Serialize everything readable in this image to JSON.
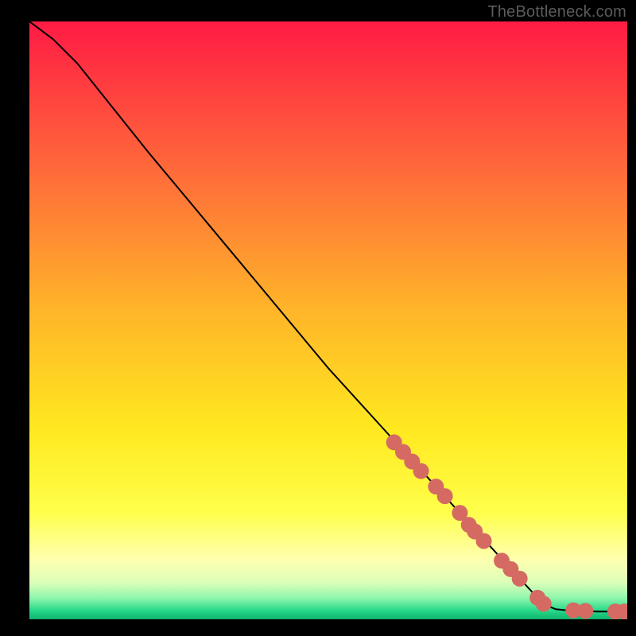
{
  "source_label": "TheBottleneck.com",
  "chart_data": {
    "type": "line",
    "title": "",
    "xlabel": "",
    "ylabel": "",
    "xlim": [
      0,
      100
    ],
    "ylim": [
      0,
      100
    ],
    "curve": [
      {
        "x": 0,
        "y": 100
      },
      {
        "x": 4,
        "y": 97
      },
      {
        "x": 8,
        "y": 93
      },
      {
        "x": 12,
        "y": 88
      },
      {
        "x": 20,
        "y": 78
      },
      {
        "x": 30,
        "y": 66
      },
      {
        "x": 40,
        "y": 54
      },
      {
        "x": 50,
        "y": 42
      },
      {
        "x": 60,
        "y": 31
      },
      {
        "x": 70,
        "y": 20
      },
      {
        "x": 80,
        "y": 9
      },
      {
        "x": 86,
        "y": 2.5
      },
      {
        "x": 88,
        "y": 1.7
      },
      {
        "x": 90,
        "y": 1.5
      },
      {
        "x": 95,
        "y": 1.3
      },
      {
        "x": 100,
        "y": 1.3
      }
    ],
    "markers": [
      {
        "x": 61.0,
        "y": 29.6
      },
      {
        "x": 62.5,
        "y": 28.0
      },
      {
        "x": 64.0,
        "y": 26.4
      },
      {
        "x": 65.5,
        "y": 24.8
      },
      {
        "x": 68.0,
        "y": 22.2
      },
      {
        "x": 69.5,
        "y": 20.6
      },
      {
        "x": 72.0,
        "y": 17.8
      },
      {
        "x": 73.5,
        "y": 15.8
      },
      {
        "x": 74.5,
        "y": 14.7
      },
      {
        "x": 76.0,
        "y": 13.1
      },
      {
        "x": 79.0,
        "y": 9.8
      },
      {
        "x": 80.5,
        "y": 8.4
      },
      {
        "x": 82.0,
        "y": 6.8
      },
      {
        "x": 85.0,
        "y": 3.6
      },
      {
        "x": 86.0,
        "y": 2.6
      },
      {
        "x": 91.0,
        "y": 1.5
      },
      {
        "x": 93.0,
        "y": 1.4
      },
      {
        "x": 98.0,
        "y": 1.3
      },
      {
        "x": 99.5,
        "y": 1.3
      }
    ],
    "gradient_stops": [
      {
        "offset": 0.0,
        "color": "#ff1b44"
      },
      {
        "offset": 0.25,
        "color": "#ff6a3a"
      },
      {
        "offset": 0.48,
        "color": "#ffb429"
      },
      {
        "offset": 0.68,
        "color": "#ffe81f"
      },
      {
        "offset": 0.82,
        "color": "#ffff4a"
      },
      {
        "offset": 0.9,
        "color": "#ffffb0"
      },
      {
        "offset": 0.94,
        "color": "#d9ffb8"
      },
      {
        "offset": 0.965,
        "color": "#8cf5ac"
      },
      {
        "offset": 0.985,
        "color": "#28d98a"
      },
      {
        "offset": 1.0,
        "color": "#0fb36e"
      }
    ],
    "marker_color": "#d46a62",
    "marker_radius": 10
  }
}
